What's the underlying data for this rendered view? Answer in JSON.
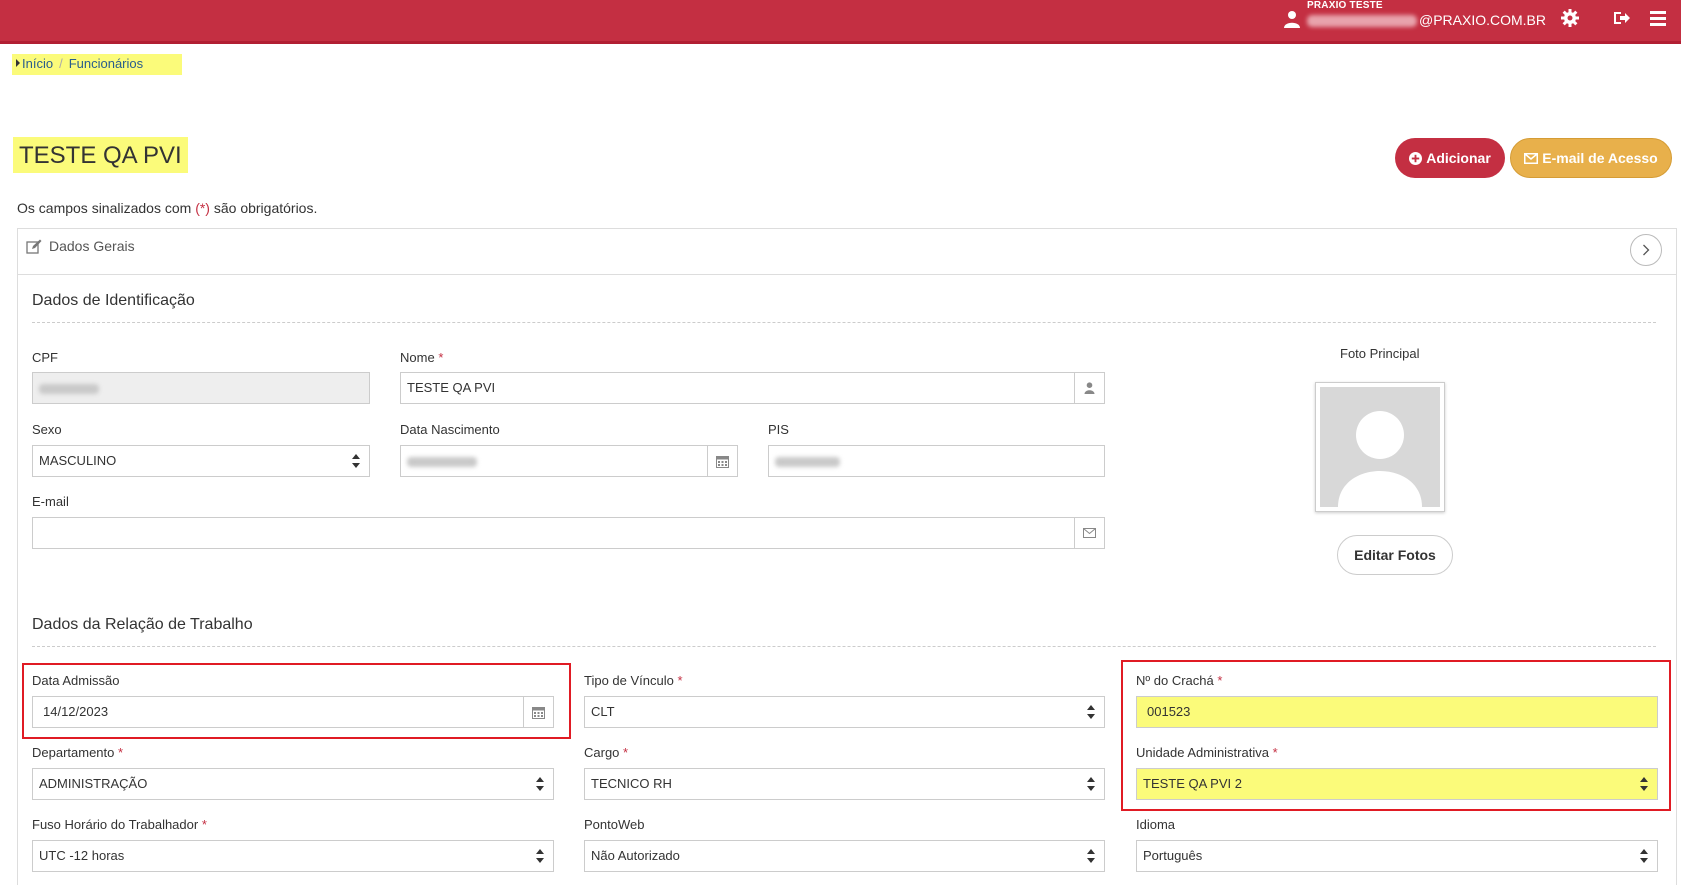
{
  "header": {
    "tenant": "PRAXIO TESTE",
    "email_domain": "@PRAXIO.COM.BR",
    "icons": [
      "user-icon",
      "gear-icon",
      "logout-icon",
      "menu-icon"
    ],
    "color": "#c42f42"
  },
  "breadcrumb": {
    "home": "Início",
    "separator": "/",
    "current": "Funcionários"
  },
  "page": {
    "title": "TESTE QA PVI",
    "add_label": "Adicionar",
    "email_access_label": "E-mail de Acesso",
    "required_note_prefix": "Os campos sinalizados com ",
    "required_note_mark": "(*)",
    "required_note_suffix": " são obrigatórios."
  },
  "panel": {
    "title": "Dados Gerais"
  },
  "identification": {
    "title": "Dados de Identificação",
    "cpf_label": "CPF",
    "nome_label": "Nome",
    "nome_value": "TESTE QA PVI",
    "sexo_label": "Sexo",
    "sexo_value": "MASCULINO",
    "nascimento_label": "Data Nascimento",
    "pis_label": "PIS",
    "email_label": "E-mail",
    "email_value": ""
  },
  "photo": {
    "title": "Foto Principal",
    "edit_label": "Editar Fotos"
  },
  "work": {
    "title": "Dados da Relação de Trabalho",
    "admissao_label": "Data Admissão",
    "admissao_value": "14/12/2023",
    "vinculo_label": "Tipo de Vínculo",
    "vinculo_value": "CLT",
    "cracha_label": "Nº do Crachá",
    "cracha_value": "001523",
    "departamento_label": "Departamento",
    "departamento_value": "ADMINISTRAÇÃO",
    "cargo_label": "Cargo",
    "cargo_value": "TECNICO RH",
    "unidade_label": "Unidade Administrativa",
    "unidade_value": "TESTE QA PVI 2",
    "fuso_label": "Fuso Horário do Trabalhador",
    "fuso_value": "UTC -12 horas",
    "pontoweb_label": "PontoWeb",
    "pontoweb_value": "Não Autorizado",
    "idioma_label": "Idioma",
    "idioma_value": "Português"
  },
  "required_mark": "*"
}
